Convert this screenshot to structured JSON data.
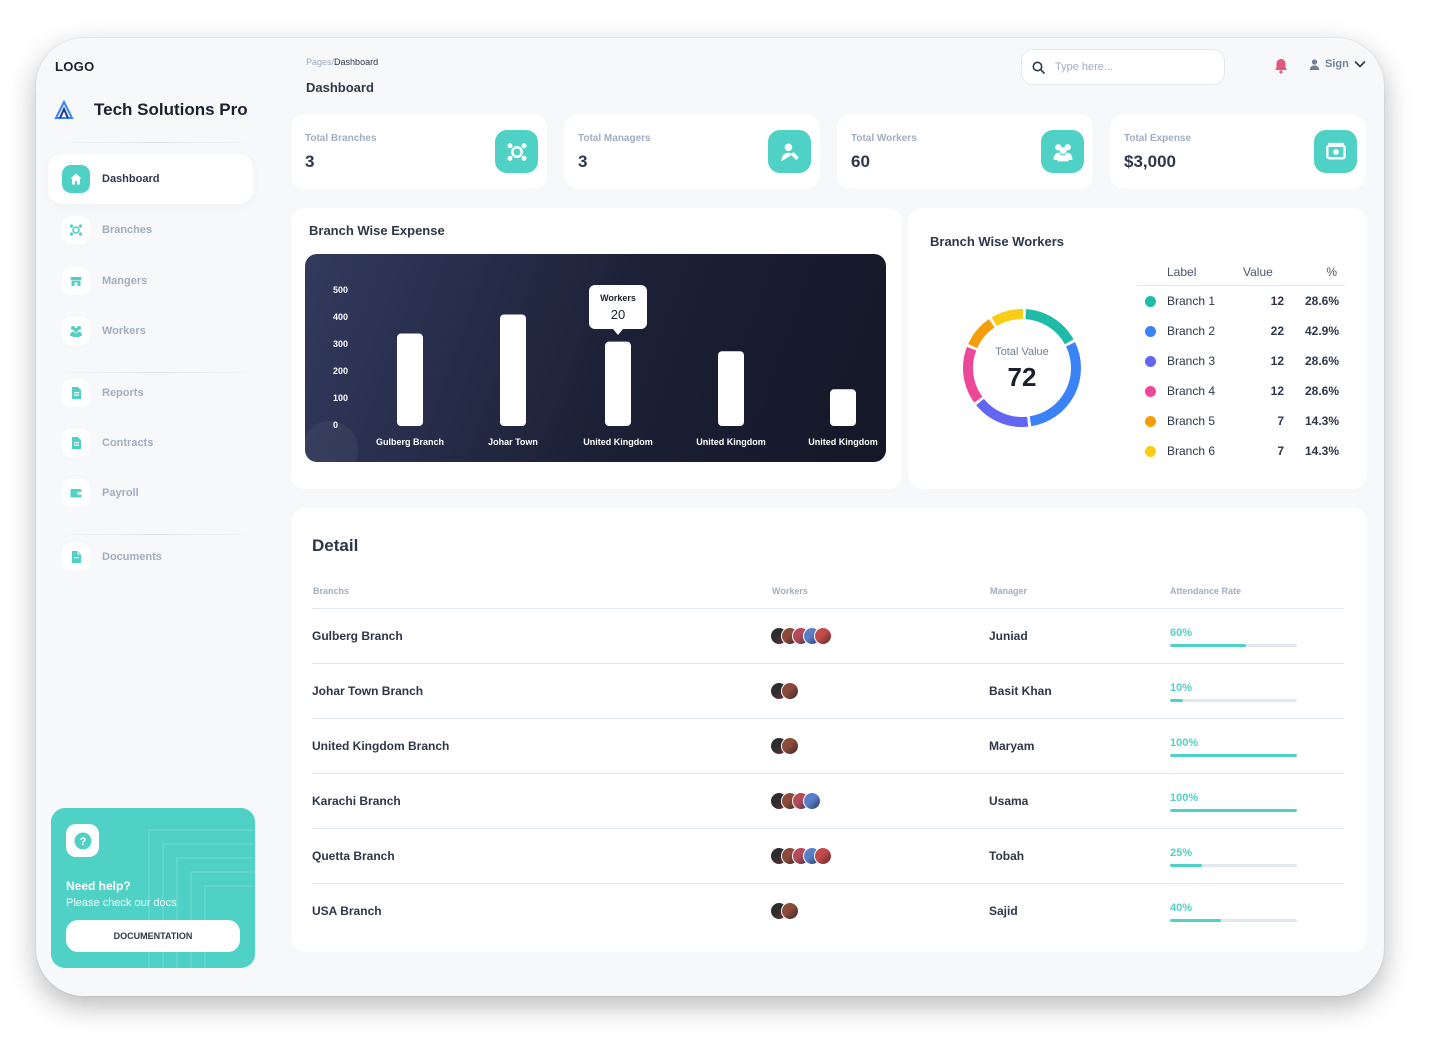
{
  "sidebar": {
    "logo": "LOGO",
    "app_name": "Tech Solutions Pro",
    "items": [
      {
        "label": "Dashboard",
        "icon": "home-icon"
      },
      {
        "label": "Branches",
        "icon": "branches-icon"
      },
      {
        "label": "Mangers",
        "icon": "store-icon"
      },
      {
        "label": "Workers",
        "icon": "workers-icon"
      },
      {
        "label": "Reports",
        "icon": "document-icon"
      },
      {
        "label": "Contracts",
        "icon": "document-icon"
      },
      {
        "label": "Payroll",
        "icon": "wallet-icon"
      },
      {
        "label": "Documents",
        "icon": "file-icon"
      }
    ],
    "help": {
      "title": "Need help?",
      "subtitle": "Please check our docs",
      "button": "DOCUMENTATION"
    }
  },
  "header": {
    "breadcrumb_parent": "Pages",
    "breadcrumb_sep": "/",
    "breadcrumb_current": "Dashboard",
    "title": "Dashboard",
    "search_placeholder": "Type here...",
    "signin": "Sign"
  },
  "stats": [
    {
      "label": "Total Branches",
      "value": "3",
      "icon": "branches-icon"
    },
    {
      "label": "Total Managers",
      "value": "3",
      "icon": "manager-icon"
    },
    {
      "label": "Total Workers",
      "value": "60",
      "icon": "workers-icon"
    },
    {
      "label": "Total Expense",
      "value": "$3,000",
      "icon": "expense-icon"
    }
  ],
  "expense": {
    "title": "Branch Wise Expense",
    "tooltip": {
      "label": "Workers",
      "value": "20"
    }
  },
  "workers": {
    "title": "Branch Wise Workers",
    "center_label": "Total Value",
    "center_value": "72",
    "headers": {
      "label": "Label",
      "value": "Value",
      "pct": "%"
    },
    "rows": [
      {
        "label": "Branch 1",
        "value": "12",
        "pct": "28.6%",
        "color": "#1ebba9"
      },
      {
        "label": "Branch 2",
        "value": "22",
        "pct": "42.9%",
        "color": "#3b82f6"
      },
      {
        "label": "Branch 3",
        "value": "12",
        "pct": "28.6%",
        "color": "#6366f1"
      },
      {
        "label": "Branch 4",
        "value": "12",
        "pct": "28.6%",
        "color": "#ec4899"
      },
      {
        "label": "Branch 5",
        "value": "7",
        "pct": "14.3%",
        "color": "#f59e0b"
      },
      {
        "label": "Branch 6",
        "value": "7",
        "pct": "14.3%",
        "color": "#facc15"
      }
    ]
  },
  "detail": {
    "title": "Detail",
    "columns": [
      "Branchs",
      "Workers",
      "Manager",
      "Attendance Rate"
    ],
    "rows": [
      {
        "branch": "Gulberg Branch",
        "avatars": 5,
        "manager": "Juniad",
        "rate_label": "60%",
        "rate": 0.6
      },
      {
        "branch": "Johar Town Branch",
        "avatars": 2,
        "manager": "Basit Khan",
        "rate_label": "10%",
        "rate": 0.1
      },
      {
        "branch": "United Kingdom Branch",
        "avatars": 2,
        "manager": "Maryam",
        "rate_label": "100%",
        "rate": 1.0
      },
      {
        "branch": "Karachi Branch",
        "avatars": 4,
        "manager": "Usama",
        "rate_label": "100%",
        "rate": 1.0
      },
      {
        "branch": "Quetta Branch",
        "avatars": 5,
        "manager": "Tobah",
        "rate_label": "25%",
        "rate": 0.25
      },
      {
        "branch": "USA Branch",
        "avatars": 2,
        "manager": "Sajid",
        "rate_label": "40%",
        "rate": 0.4
      }
    ]
  },
  "colors": {
    "accent": "#4fd1c5",
    "dark": "#1c2035"
  },
  "chart_data": [
    {
      "type": "bar",
      "title": "Branch Wise Expense",
      "categories": [
        "Gulberg Branch",
        "Johar Town",
        "United Kingdom",
        "United Kingdom",
        "United Kingdom"
      ],
      "values": [
        340,
        410,
        310,
        275,
        135
      ],
      "yticks": [
        500,
        400,
        300,
        200,
        100,
        0
      ],
      "ylim": [
        0,
        500
      ]
    },
    {
      "type": "pie",
      "title": "Branch Wise Workers",
      "labels": [
        "Branch 1",
        "Branch 2",
        "Branch 3",
        "Branch 4",
        "Branch 5",
        "Branch 6"
      ],
      "values": [
        12,
        22,
        12,
        12,
        7,
        7
      ]
    }
  ]
}
